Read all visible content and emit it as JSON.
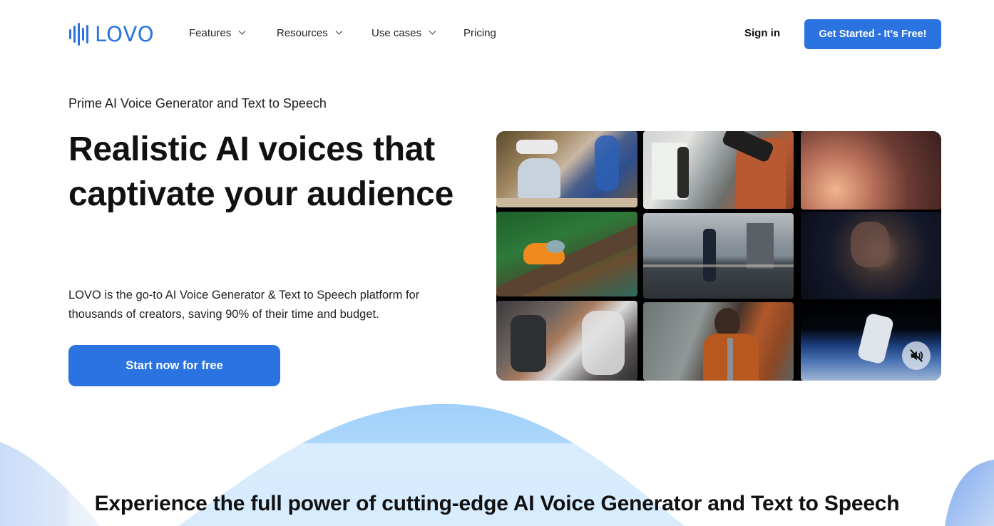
{
  "brand": {
    "name": "LOVO",
    "accent_color": "#2a73e0"
  },
  "nav": {
    "items": [
      {
        "label": "Features",
        "has_dropdown": true
      },
      {
        "label": "Resources",
        "has_dropdown": true
      },
      {
        "label": "Use cases",
        "has_dropdown": true
      },
      {
        "label": "Pricing",
        "has_dropdown": false
      }
    ],
    "sign_in": "Sign in",
    "cta": "Get Started - It’s Free!"
  },
  "hero": {
    "eyebrow": "Prime AI Voice Generator and Text to Speech",
    "headline": "Realistic AI voices that captivate your audience",
    "description": "LOVO is the go-to AI Voice Generator & Text to Speech platform for thousands of creators, saving 90% of their time and budget.",
    "cta": "Start now for free"
  },
  "media": {
    "tiles": [
      {
        "scene": "woman-in-vr-headset-with-avatar"
      },
      {
        "scene": "photographer-on-pier"
      },
      {
        "scene": "audio-mixing-console"
      },
      {
        "scene": "orange-frog-on-branch"
      },
      {
        "scene": "woman-running-by-harbor"
      },
      {
        "scene": "woman-lit-by-phone"
      },
      {
        "scene": "person-with-robot-arm"
      },
      {
        "scene": "teacher-at-chalkboard"
      },
      {
        "scene": "satellite-over-earth"
      }
    ],
    "mute_icon": "speaker-muted-icon"
  },
  "section": {
    "title": "Experience the full power of cutting-edge AI Voice Generator and Text to Speech"
  }
}
